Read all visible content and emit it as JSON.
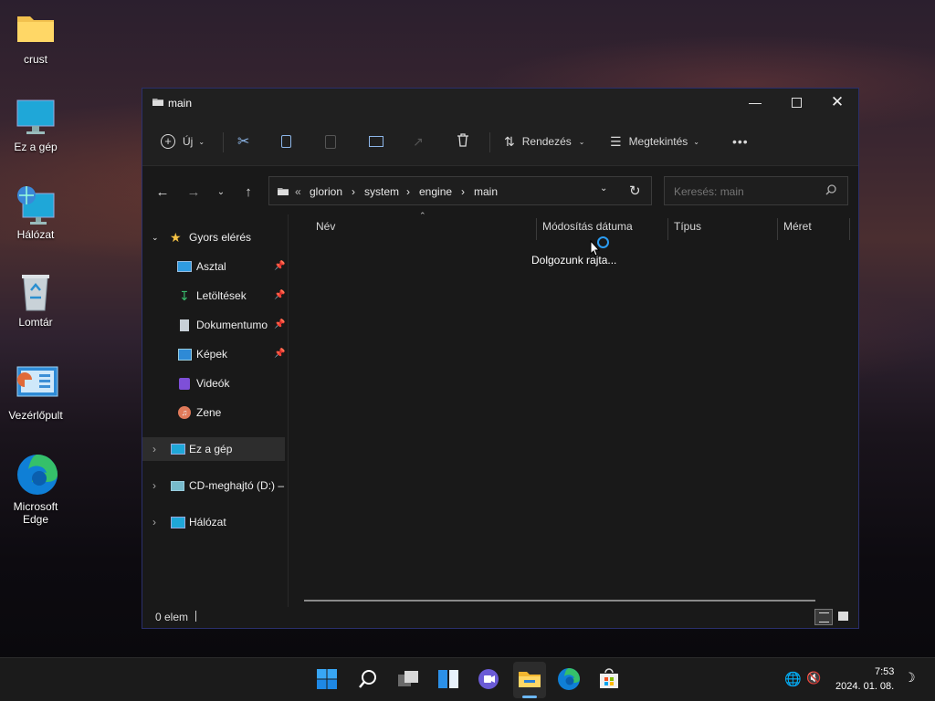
{
  "desktop": {
    "icons": [
      {
        "label": "crust",
        "icon": "folder-icon"
      },
      {
        "label": "Ez a gép",
        "icon": "computer-icon"
      },
      {
        "label": "Hálózat",
        "icon": "network-icon"
      },
      {
        "label": "Lomtár",
        "icon": "recycle-bin-icon"
      },
      {
        "label": "Vezérlőpult",
        "icon": "control-panel-icon"
      },
      {
        "label": "Microsoft Edge",
        "icon": "edge-icon"
      }
    ]
  },
  "window": {
    "title": "main",
    "toolbar": {
      "new_label": "Új",
      "sort_label": "Rendezés",
      "view_label": "Megtekintés",
      "more_label": "•••"
    },
    "address": {
      "overflow": "«",
      "crumbs": [
        "glorion",
        "system",
        "engine",
        "main"
      ]
    },
    "search": {
      "placeholder": "Keresés: main"
    },
    "nav": {
      "quick_access": "Gyors elérés",
      "items": [
        "Asztal",
        "Letöltések",
        "Dokumentumo",
        "Képek",
        "Videók",
        "Zene"
      ],
      "this_pc": "Ez a gép",
      "cd_drive": "CD-meghajtó (D:) –",
      "network": "Hálózat"
    },
    "columns": [
      "Név",
      "Módosítás dátuma",
      "Típus",
      "Méret"
    ],
    "working_text": "Dolgozunk rajta...",
    "status": "0 elem"
  },
  "taskbar": {
    "time": "7:53",
    "date": "2024. 01. 08."
  },
  "colors": {
    "accent": "#0a84ff",
    "window_bg": "#191919",
    "toolbar_bg": "#202020"
  }
}
